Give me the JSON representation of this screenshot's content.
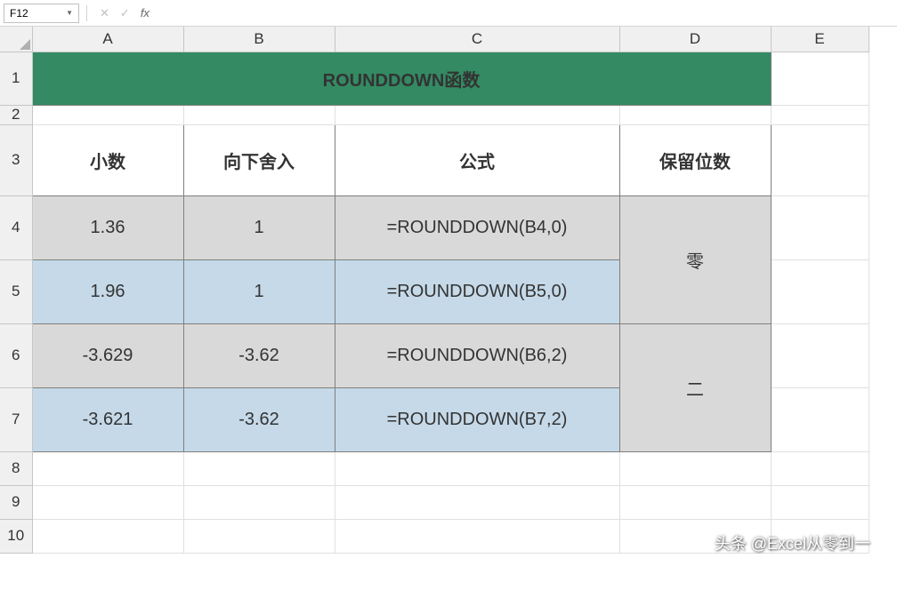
{
  "nameBox": "F12",
  "formulaBar": "",
  "columns": [
    "A",
    "B",
    "C",
    "D",
    "E"
  ],
  "rows": [
    "1",
    "2",
    "3",
    "4",
    "5",
    "6",
    "7",
    "8",
    "9",
    "10"
  ],
  "title": "ROUNDDOWN函数",
  "headers": {
    "a": "小数",
    "b": "向下舍入",
    "c": "公式",
    "d": "保留位数"
  },
  "data": [
    {
      "a": "1.36",
      "b": "1",
      "c": "=ROUNDDOWN(B4,0)"
    },
    {
      "a": "1.96",
      "b": "1",
      "c": "=ROUNDDOWN(B5,0)"
    },
    {
      "a": "-3.629",
      "b": "-3.62",
      "c": "=ROUNDDOWN(B6,2)"
    },
    {
      "a": "-3.621",
      "b": "-3.62",
      "c": "=ROUNDDOWN(B7,2)"
    }
  ],
  "merged": {
    "d1": "零",
    "d2": "二"
  },
  "watermark": "头条 @Excel从零到一"
}
